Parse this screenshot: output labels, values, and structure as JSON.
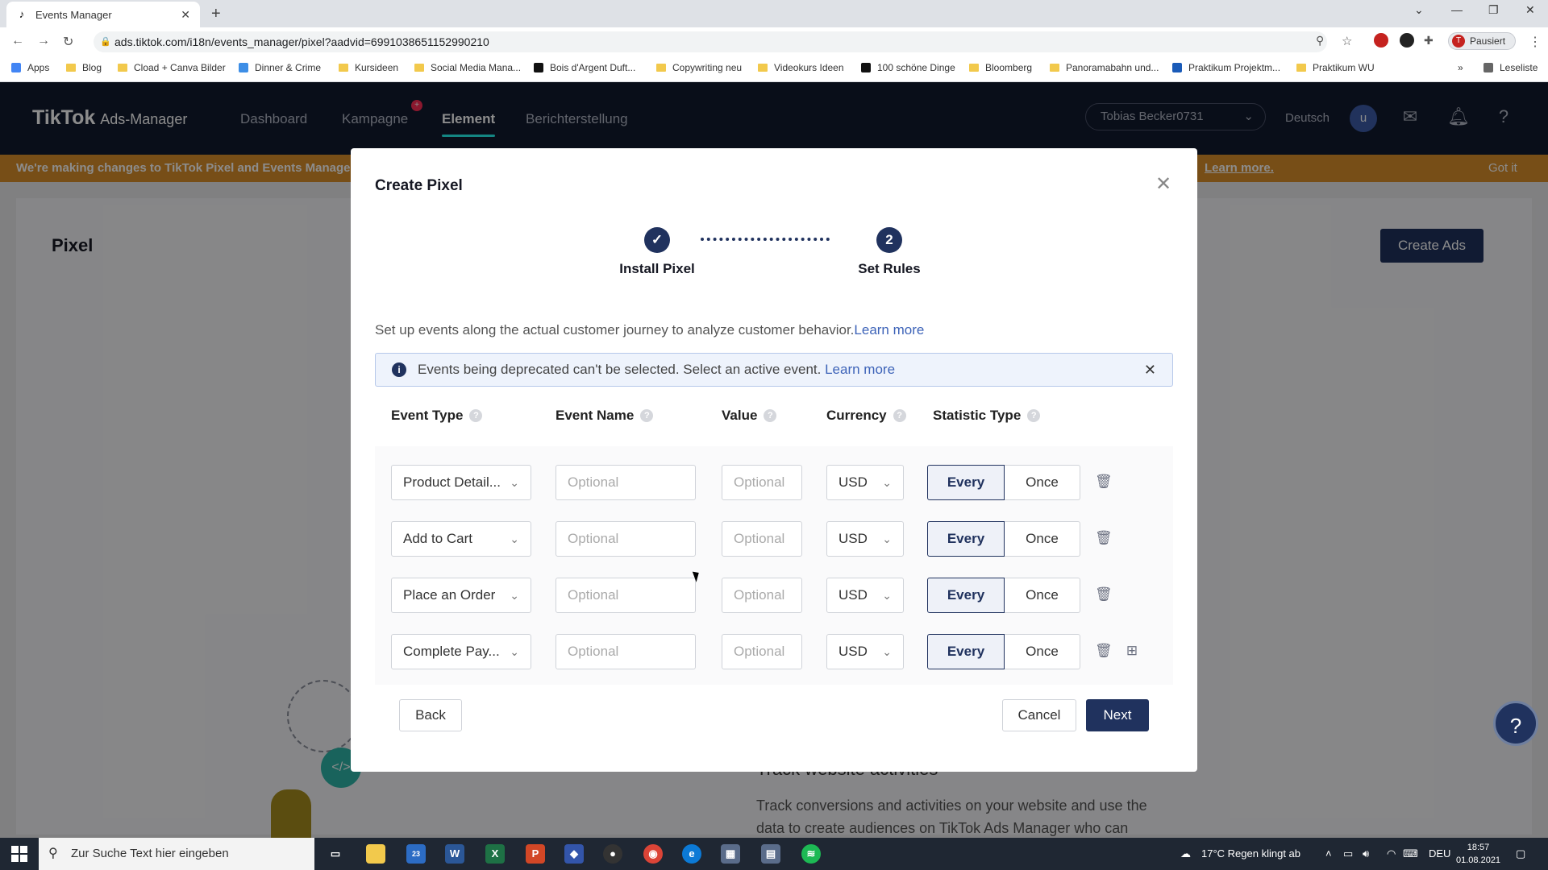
{
  "browser": {
    "tab_title": "Events Manager",
    "url": "ads.tiktok.com/i18n/events_manager/pixel?aadvid=6991038651152990210",
    "profile_label": "Pausiert",
    "profile_initial": "T",
    "bookmarks": [
      "Apps",
      "Blog",
      "Cload + Canva Bilder",
      "Dinner & Crime",
      "Kursideen",
      "Social Media Mana...",
      "Bois d'Argent Duft...",
      "Copywriting neu",
      "Videokurs Ideen",
      "100 schöne Dinge",
      "Bloomberg",
      "Panoramabahn und...",
      "Praktikum Projektm...",
      "Praktikum WU"
    ],
    "reading_list": "Leseliste"
  },
  "header": {
    "brand": "TikTok",
    "brand_sub": "Ads-Manager",
    "nav": [
      "Dashboard",
      "Kampagne",
      "Element",
      "Berichterstellung"
    ],
    "active_nav": "Element",
    "account": "Tobias Becker0731",
    "language": "Deutsch",
    "user_initial": "u"
  },
  "banner": {
    "text": "We're making changes to TikTok Pixel and Events Manager! B",
    "learn_more": "Learn more.",
    "got_it": "Got it"
  },
  "page": {
    "title": "Pixel",
    "create_ads": "Create Ads",
    "bg_heading": "Track website activities",
    "bg_text": "Track conversions and activities on your website and use the data to create audiences on TikTok Ads Manager who can"
  },
  "modal": {
    "title": "Create Pixel",
    "steps": [
      {
        "label": "Install Pixel",
        "marker": "✓"
      },
      {
        "label": "Set Rules",
        "marker": "2"
      }
    ],
    "intro": "Set up events along the actual customer journey to analyze customer behavior.",
    "intro_link": "Learn more",
    "info": "Events being deprecated can't be selected. Select an active event.",
    "info_link": "Learn more",
    "columns": [
      "Event Type",
      "Event Name",
      "Value",
      "Currency",
      "Statistic Type"
    ],
    "rows": [
      {
        "event_type": "Product Detail...",
        "event_name_ph": "Optional",
        "value_ph": "Optional",
        "currency": "USD",
        "every": "Every",
        "once": "Once"
      },
      {
        "event_type": "Add to Cart",
        "event_name_ph": "Optional",
        "value_ph": "Optional",
        "currency": "USD",
        "every": "Every",
        "once": "Once"
      },
      {
        "event_type": "Place an Order",
        "event_name_ph": "Optional",
        "value_ph": "Optional",
        "currency": "USD",
        "every": "Every",
        "once": "Once"
      },
      {
        "event_type": "Complete Pay...",
        "event_name_ph": "Optional",
        "value_ph": "Optional",
        "currency": "USD",
        "every": "Every",
        "once": "Once"
      }
    ],
    "back": "Back",
    "cancel": "Cancel",
    "next": "Next"
  },
  "taskbar": {
    "search_placeholder": "Zur Suche Text hier eingeben",
    "weather": "17°C  Regen klingt ab",
    "lang": "DEU",
    "time": "18:57",
    "date": "01.08.2021"
  }
}
